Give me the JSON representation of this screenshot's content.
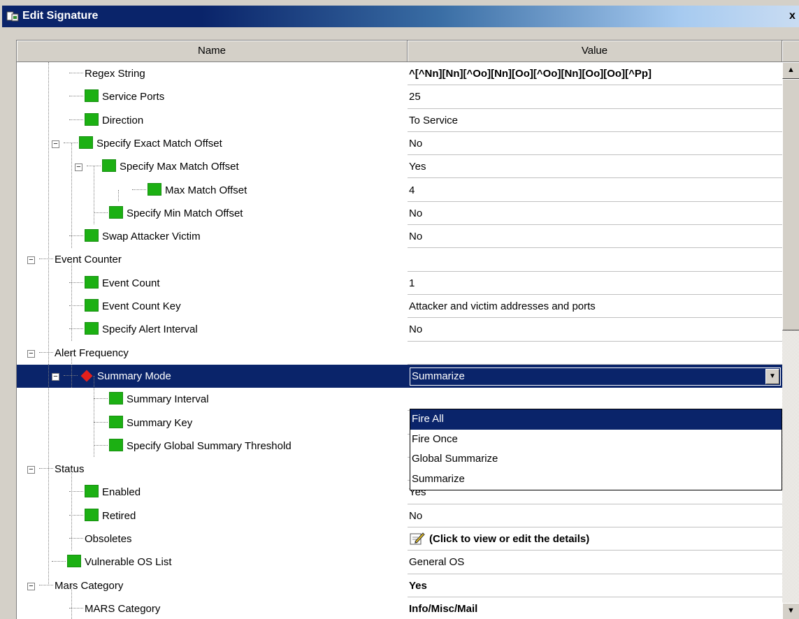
{
  "window": {
    "title": "Edit Signature",
    "close_glyph": "x",
    "app_icon": "signature-app-icon"
  },
  "grid": {
    "col_name": "Name",
    "col_value": "Value"
  },
  "rows": [
    {
      "label": "Regex String",
      "value": "^[^Nn][Nn][^Oo][Nn][Oo][^Oo][Nn][Oo][Oo][^Pp]",
      "icon": "none",
      "bold": true
    },
    {
      "label": "Service Ports",
      "value": "25",
      "icon": "green-square"
    },
    {
      "label": "Direction",
      "value": "To Service",
      "icon": "green-square"
    },
    {
      "label": "Specify Exact Match Offset",
      "value": "No",
      "icon": "green-square",
      "toggle": "minus"
    },
    {
      "label": "Specify Max Match Offset",
      "value": "Yes",
      "icon": "green-square",
      "toggle": "minus"
    },
    {
      "label": "Max Match Offset",
      "value": "4",
      "icon": "green-square"
    },
    {
      "label": "Specify Min Match Offset",
      "value": "No",
      "icon": "green-square"
    },
    {
      "label": "Swap Attacker Victim",
      "value": "No",
      "icon": "green-square"
    },
    {
      "label": "Event Counter",
      "value": "",
      "icon": "none",
      "toggle": "minus"
    },
    {
      "label": "Event Count",
      "value": "1",
      "icon": "green-square"
    },
    {
      "label": "Event Count Key",
      "value": "Attacker and victim addresses and ports",
      "icon": "green-square"
    },
    {
      "label": "Specify Alert Interval",
      "value": "No",
      "icon": "green-square"
    },
    {
      "label": "Alert Frequency",
      "value": "",
      "icon": "none",
      "toggle": "minus"
    },
    {
      "label": "Summary Mode",
      "value": "Summarize",
      "icon": "red-diamond",
      "toggle": "minus",
      "selected": true
    },
    {
      "label": "Summary Interval",
      "value": "",
      "icon": "green-square"
    },
    {
      "label": "Summary Key",
      "value": "",
      "icon": "green-square"
    },
    {
      "label": "Specify Global Summary Threshold",
      "value": "",
      "icon": "green-square"
    },
    {
      "label": "Status",
      "value": "",
      "icon": "none",
      "toggle": "minus"
    },
    {
      "label": "Enabled",
      "value": "Yes",
      "icon": "green-square"
    },
    {
      "label": "Retired",
      "value": "No",
      "icon": "green-square"
    },
    {
      "label": "Obsoletes",
      "value": "(Click to view or edit the details)",
      "icon": "none",
      "bold": true,
      "edit_icon": true
    },
    {
      "label": "Vulnerable OS List",
      "value": "General OS",
      "icon": "green-square"
    },
    {
      "label": "Mars Category",
      "value": "Yes",
      "icon": "none",
      "toggle": "minus",
      "bold": true
    },
    {
      "label": "MARS Category",
      "value": "Info/Misc/Mail",
      "icon": "none",
      "bold": true
    }
  ],
  "dropdown": {
    "options": [
      "Fire All",
      "Fire Once",
      "Global Summarize",
      "Summarize"
    ],
    "highlighted": "Fire All"
  },
  "colors": {
    "selection": "#0a246a",
    "green_icon": "#1cb013",
    "red_icon": "#e3201b"
  }
}
